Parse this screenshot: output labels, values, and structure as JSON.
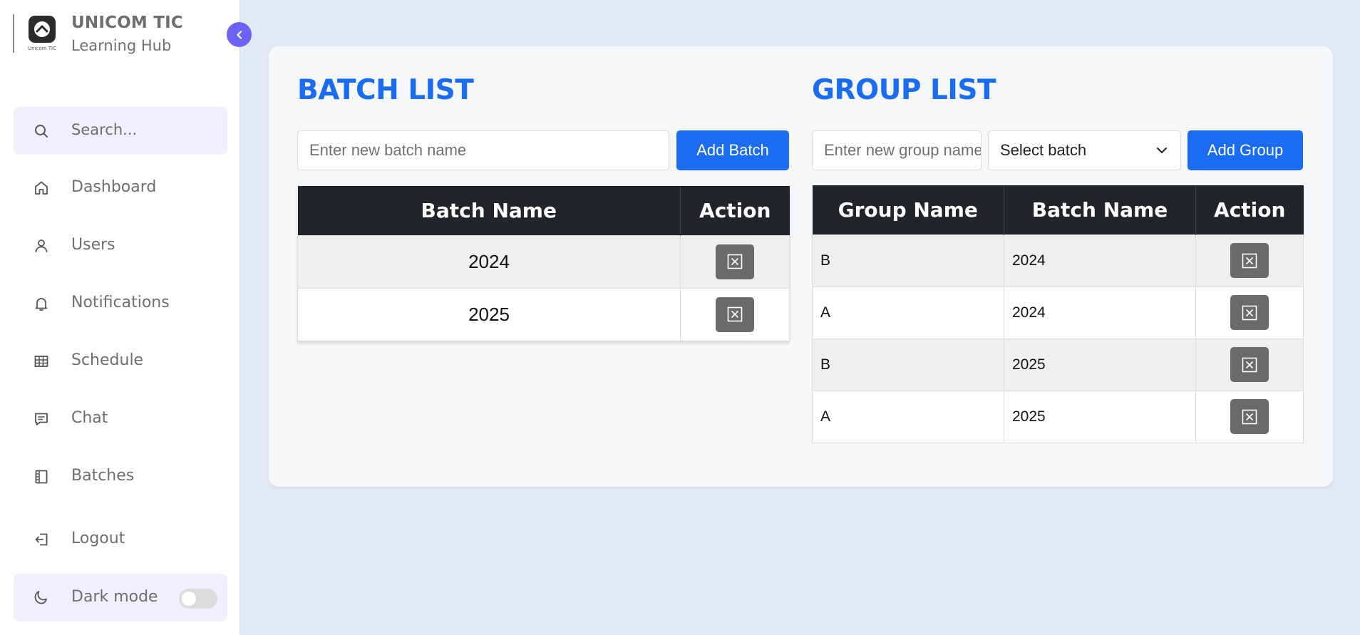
{
  "brand": {
    "title": "UNICOM TIC",
    "subtitle": "Learning Hub",
    "logo_text": "Unicom TIC"
  },
  "sidebar": {
    "search_placeholder": "Search...",
    "items": [
      {
        "label": "Dashboard",
        "icon": "home-icon"
      },
      {
        "label": "Users",
        "icon": "user-icon"
      },
      {
        "label": "Notifications",
        "icon": "bell-icon"
      },
      {
        "label": "Schedule",
        "icon": "table-icon"
      },
      {
        "label": "Chat",
        "icon": "chat-icon"
      },
      {
        "label": "Batches",
        "icon": "batches-icon"
      },
      {
        "label": "Logout",
        "icon": "logout-icon"
      }
    ],
    "dark_mode_label": "Dark mode",
    "dark_mode_on": false
  },
  "batch_section": {
    "title": "BATCH LIST",
    "input_placeholder": "Enter new batch name",
    "add_button": "Add Batch",
    "headers": [
      "Batch Name",
      "Action"
    ],
    "rows": [
      "2024",
      "2025"
    ]
  },
  "group_section": {
    "title": "GROUP LIST",
    "input_placeholder": "Enter new group name",
    "select_value": "Select batch",
    "add_button": "Add Group",
    "headers": [
      "Group Name",
      "Batch Name",
      "Action"
    ],
    "rows": [
      {
        "group": "B",
        "batch": "2024"
      },
      {
        "group": "A",
        "batch": "2024"
      },
      {
        "group": "B",
        "batch": "2025"
      },
      {
        "group": "A",
        "batch": "2025"
      }
    ]
  },
  "colors": {
    "accent": "#1a6cf2",
    "sidebar_highlight": "#f1effd",
    "collapse_button": "#6c63f5",
    "table_header": "#212529",
    "delete_button": "#6a6a6a",
    "background": "#e3e8f5"
  }
}
